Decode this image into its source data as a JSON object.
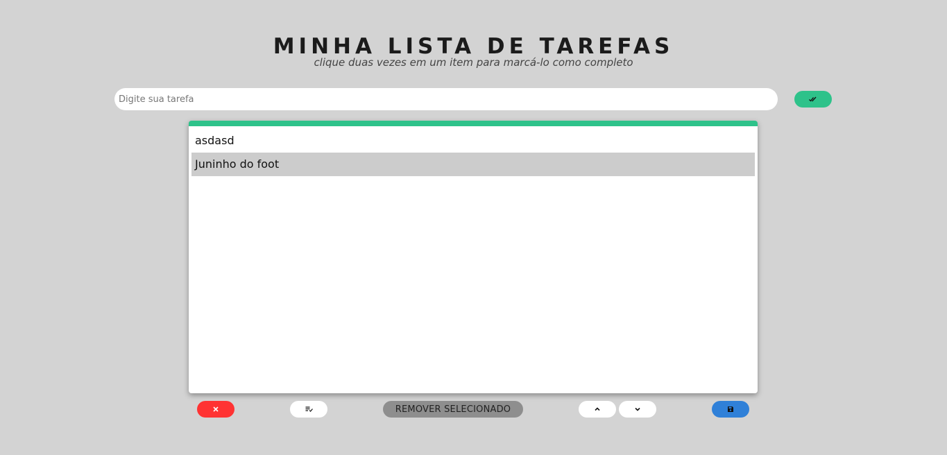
{
  "header": {
    "title": "MINHA LISTA DE TAREFAS",
    "subtitle": "clique duas vezes em um item para marcá-lo como completo"
  },
  "input": {
    "placeholder": "Digite sua tarefa",
    "value": ""
  },
  "add_button": {
    "icon": "double-check-icon"
  },
  "list": {
    "items": [
      {
        "label": "asdasd",
        "selected": false
      },
      {
        "label": "Juninho do foot",
        "selected": true
      }
    ]
  },
  "toolbar": {
    "clear_icon": "close-icon",
    "complete_icon": "playlist-check-icon",
    "remove_label": "REMOVER SELECIONADO",
    "up_icon": "chevron-up-icon",
    "down_icon": "chevron-down-icon",
    "save_icon": "save-icon"
  },
  "colors": {
    "background": "#d3d3d3",
    "accent_green": "#2ec28a",
    "danger_red": "#ff3333",
    "remove_gray": "#8e8e8e",
    "save_blue": "#2f80d8",
    "selected_row": "#cccccc"
  }
}
